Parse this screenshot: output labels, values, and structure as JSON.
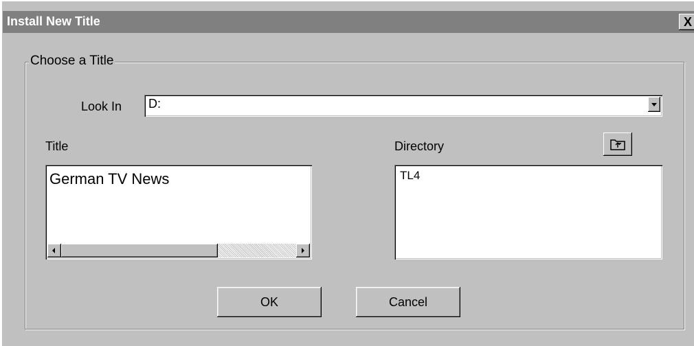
{
  "window": {
    "title": "Install New Title",
    "close_label": "X"
  },
  "group": {
    "legend": "Choose a Title"
  },
  "look_in": {
    "label": "Look In",
    "value": "D:"
  },
  "title_list": {
    "header": "Title",
    "items": [
      "German TV News"
    ]
  },
  "directory_list": {
    "header": "Directory",
    "items": [
      "TL4"
    ]
  },
  "buttons": {
    "ok": "OK",
    "cancel": "Cancel"
  },
  "icons": {
    "up_folder": "up-one-level-folder-icon"
  }
}
